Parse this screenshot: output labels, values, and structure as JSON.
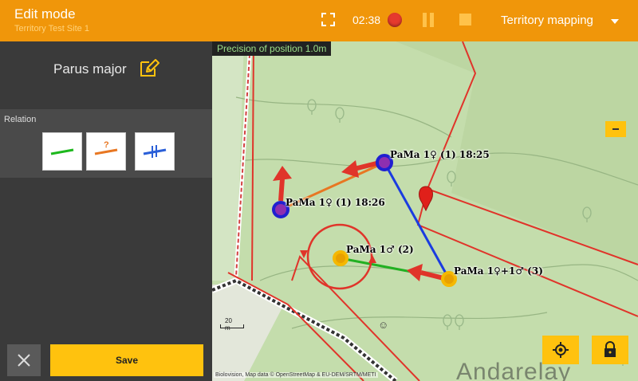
{
  "topbar": {
    "title": "Edit mode",
    "subtitle": "Territory Test Site 1",
    "timer": "02:38",
    "mode": "Territory mapping"
  },
  "panel": {
    "species": "Parus major",
    "relation_label": "Relation",
    "relations": [
      {
        "name": "simultaneous",
        "color": "#1DB81D"
      },
      {
        "name": "uncertain",
        "color": "#E87722",
        "mark": "?"
      },
      {
        "name": "separate",
        "color": "#2A5FD8"
      }
    ],
    "save_label": "Save"
  },
  "map": {
    "precision": "Precision of position 1.0m",
    "scale": "20 m",
    "attribution": "Biolovision, Map data © OpenStreetMap & EU-DEM/SRTM/METI",
    "place": "Andarelay",
    "smiley": "☺",
    "observations": [
      {
        "label": "PaMa 1♀ (1) 18:25",
        "color": "#2020D0"
      },
      {
        "label": "PaMa 1♀ (1) 18:26",
        "color": "#2020D0"
      },
      {
        "label": "PaMa 1♂ (2)",
        "color": "#F5B800"
      },
      {
        "label": "PaMa 1♀+1♂ (3)",
        "color": "#F5B800"
      }
    ]
  },
  "colors": {
    "accent": "#F0960A",
    "button": "#FFC20E",
    "territory_line": "#E0342A"
  }
}
